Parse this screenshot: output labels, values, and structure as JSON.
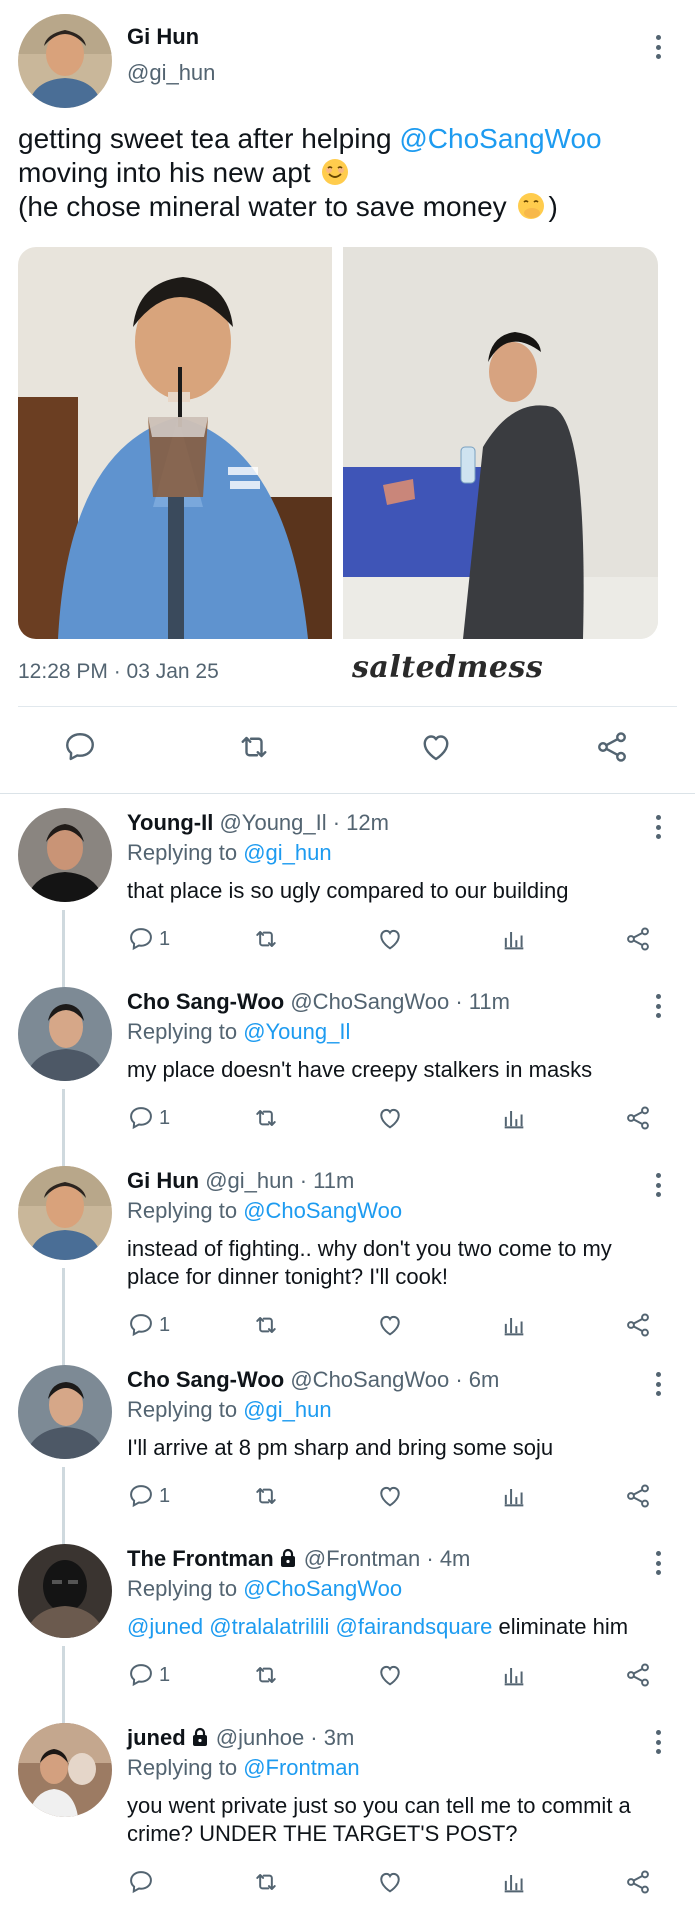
{
  "main_tweet": {
    "author_name": "Gi Hun",
    "author_handle": "@gi_hun",
    "text_line1_prefix": "getting sweet tea after helping ",
    "text_line1_mention": "@ChoSangWoo",
    "text_line2": "moving into his new apt ",
    "text_line3": "(he chose mineral water to save money ",
    "text_line3_suffix": ")",
    "emoji_1": "smiling-face-emoji",
    "emoji_2": "face-with-hand-over-mouth-emoji",
    "timestamp": "12:28 PM · 03 Jan 25",
    "watermark": "saltedmess",
    "actions": [
      "reply-icon",
      "retweet-icon",
      "like-icon",
      "share-icon"
    ]
  },
  "replies": [
    {
      "name": "Young-Il",
      "meta": " @Young_Il · 12m",
      "replying_label": "Replying to ",
      "replying_to": "@gi_hun",
      "text": "that place is so ugly compared to our building",
      "reply_count": "1",
      "locked": false
    },
    {
      "name": "Cho Sang-Woo",
      "meta": " @ChoSangWoo · 11m",
      "replying_label": "Replying to ",
      "replying_to": "@Young_Il",
      "text": "my place doesn't have creepy stalkers in masks",
      "reply_count": "1",
      "locked": false
    },
    {
      "name": "Gi Hun",
      "meta": " @gi_hun · 11m",
      "replying_label": "Replying to ",
      "replying_to": "@ChoSangWoo",
      "text": "instead of fighting.. why don't you two come to my place for dinner tonight? I'll cook!",
      "reply_count": "1",
      "locked": false
    },
    {
      "name": "Cho Sang-Woo",
      "meta": " @ChoSangWoo · 6m",
      "replying_label": "Replying to ",
      "replying_to": "@gi_hun",
      "text": "I'll arrive at 8 pm sharp and bring some soju",
      "reply_count": "1",
      "locked": false
    },
    {
      "name": "The Frontman",
      "meta": " @Frontman · 4m",
      "replying_label": "Replying to ",
      "replying_to": "@ChoSangWoo",
      "text_mentions": "@juned @tralalatrilili @fairandsquare",
      "text": " eliminate him",
      "reply_count": "1",
      "locked": true
    },
    {
      "name": "juned",
      "meta": " @junhoe · 3m",
      "replying_label": "Replying to ",
      "replying_to": "@Frontman",
      "text": "you went private just so you can tell me to commit a crime? UNDER THE TARGET'S POST?",
      "reply_count": "",
      "locked": true
    }
  ],
  "colors": {
    "link": "#1d9bf0",
    "secondary_text": "#536471",
    "primary_text": "#0f1419",
    "divider": "#e1e8ed"
  }
}
